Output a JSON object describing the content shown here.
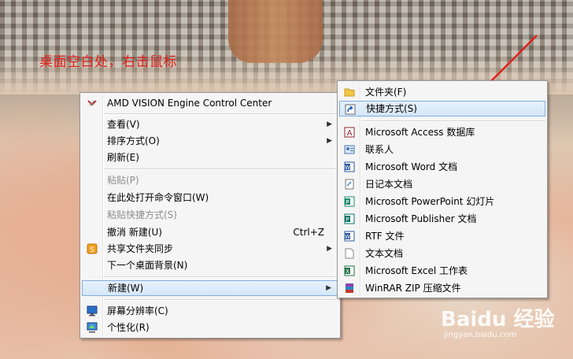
{
  "annotation": "桌面空白处，右击鼠标",
  "main_menu": {
    "items": [
      {
        "label": "AMD VISION Engine Control Center"
      },
      {
        "label": "查看(V)"
      },
      {
        "label": "排序方式(O)"
      },
      {
        "label": "刷新(E)"
      },
      {
        "label": "粘贴(P)"
      },
      {
        "label": "在此处打开命令窗口(W)"
      },
      {
        "label": "粘贴快捷方式(S)"
      },
      {
        "label": "撤消 新建(U)",
        "shortcut": "Ctrl+Z"
      },
      {
        "label": "共享文件夹同步"
      },
      {
        "label": "下一个桌面背景(N)"
      },
      {
        "label": "新建(W)"
      },
      {
        "label": "屏幕分辨率(C)"
      },
      {
        "label": "个性化(R)"
      }
    ]
  },
  "sub_menu": {
    "items": [
      {
        "label": "文件夹(F)",
        "icon": "folder-icon"
      },
      {
        "label": "快捷方式(S)",
        "icon": "shortcut-icon"
      },
      {
        "label": "Microsoft Access 数据库",
        "icon": "access-icon"
      },
      {
        "label": "联系人",
        "icon": "contact-icon"
      },
      {
        "label": "Microsoft Word 文档",
        "icon": "word-icon"
      },
      {
        "label": "日记本文档",
        "icon": "journal-icon"
      },
      {
        "label": "Microsoft PowerPoint 幻灯片",
        "icon": "powerpoint-icon"
      },
      {
        "label": "Microsoft Publisher 文档",
        "icon": "publisher-icon"
      },
      {
        "label": "RTF 文件",
        "icon": "rtf-icon"
      },
      {
        "label": "文本文档",
        "icon": "text-icon"
      },
      {
        "label": "Microsoft Excel 工作表",
        "icon": "excel-icon"
      },
      {
        "label": "WinRAR ZIP 压缩文件",
        "icon": "winrar-icon"
      }
    ]
  },
  "watermark": {
    "logo": "Baidu 经验",
    "url": "jingyan.baidu.com"
  },
  "colors": {
    "annotation": "#e0201a",
    "highlight_border": "#84acdd",
    "menu_bg": "#f5f5f5"
  }
}
